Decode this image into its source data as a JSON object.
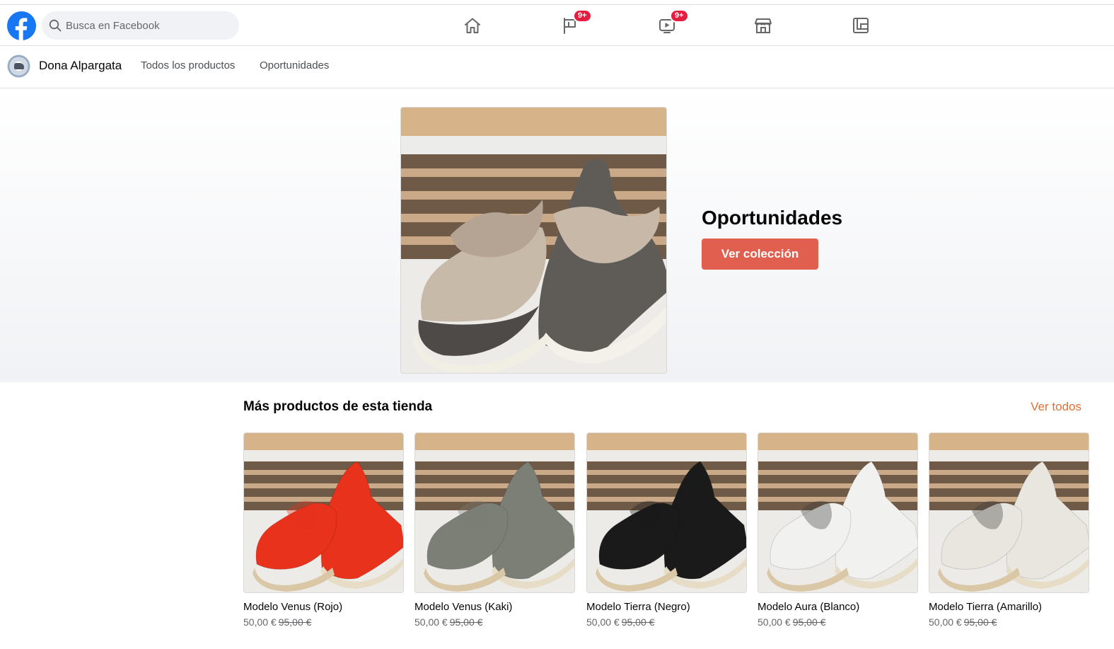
{
  "header": {
    "logo": "facebook-logo",
    "search": {
      "placeholder": "Busca en Facebook",
      "value": ""
    },
    "nav": [
      {
        "name": "home-icon"
      },
      {
        "name": "pages-flag-icon",
        "badge": "9+"
      },
      {
        "name": "watch-video-icon",
        "badge": "9+"
      },
      {
        "name": "marketplace-store-icon"
      },
      {
        "name": "gaming-icon"
      }
    ],
    "badge_color": "#e41e3f"
  },
  "shop": {
    "name": "Dona Alpargata",
    "links": [
      "Todos los productos",
      "Oportunidades"
    ]
  },
  "hero": {
    "title": "Oportunidades",
    "button": "Ver colección",
    "button_color": "#e15f4f"
  },
  "products_section": {
    "title": "Más productos de esta tienda",
    "see_all": "Ver todos",
    "items": [
      {
        "name": "Modelo Venus (Rojo)",
        "price": "50,00 €",
        "old_price": "95,00 €",
        "color": "#e8321c"
      },
      {
        "name": "Modelo Venus (Kaki)",
        "price": "50,00 €",
        "old_price": "95,00 €",
        "color": "#7b7f76"
      },
      {
        "name": "Modelo Tierra (Negro)",
        "price": "50,00 €",
        "old_price": "95,00 €",
        "color": "#1a1a1a"
      },
      {
        "name": "Modelo Aura (Blanco)",
        "price": "50,00 €",
        "old_price": "95,00 €",
        "color": "#f1f1ef"
      },
      {
        "name": "Modelo Tierra (Amarillo)",
        "price": "50,00 €",
        "old_price": "95,00 €",
        "color": "#e9e6df"
      }
    ]
  }
}
